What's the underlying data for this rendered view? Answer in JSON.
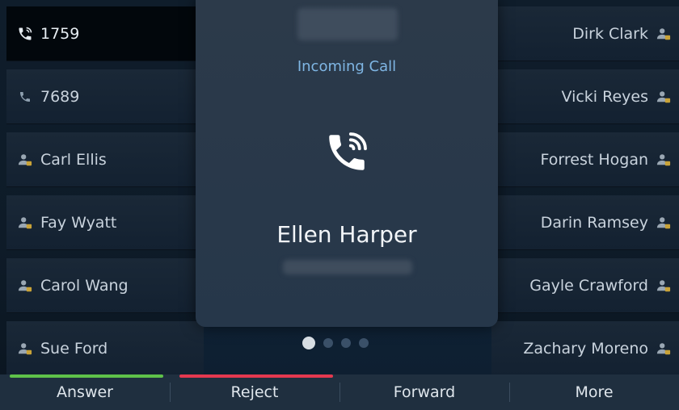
{
  "left_lines": [
    {
      "label": "1759",
      "icon": "ringing-phone-icon",
      "active": true
    },
    {
      "label": "7689",
      "icon": "phone-icon",
      "active": false
    },
    {
      "label": "Carl Ellis",
      "icon": "contact-icon",
      "active": false
    },
    {
      "label": "Fay Wyatt",
      "icon": "contact-icon",
      "active": false
    },
    {
      "label": "Carol Wang",
      "icon": "contact-icon",
      "active": false
    },
    {
      "label": "Sue Ford",
      "icon": "contact-icon",
      "active": false
    }
  ],
  "right_lines": [
    {
      "label": "Dirk Clark",
      "icon": "contact-icon"
    },
    {
      "label": "Vicki Reyes",
      "icon": "contact-icon"
    },
    {
      "label": "Forrest Hogan",
      "icon": "contact-icon"
    },
    {
      "label": "Darin Ramsey",
      "icon": "contact-icon"
    },
    {
      "label": "Gayle Crawford",
      "icon": "contact-icon"
    },
    {
      "label": "Zachary Moreno",
      "icon": "contact-icon"
    }
  ],
  "call": {
    "status": "Incoming Call",
    "caller_name": "Ellen Harper",
    "icon": "ringing-phone-icon"
  },
  "pager": {
    "total": 4,
    "current": 1
  },
  "softkeys": [
    {
      "label": "Answer",
      "accent": "#5fc24a"
    },
    {
      "label": "Reject",
      "accent": "#e5394f"
    },
    {
      "label": "Forward",
      "accent": ""
    },
    {
      "label": "More",
      "accent": ""
    }
  ],
  "colors": {
    "status_text": "#7fb6e4",
    "answer_green": "#5fc24a",
    "reject_red": "#e5394f"
  }
}
